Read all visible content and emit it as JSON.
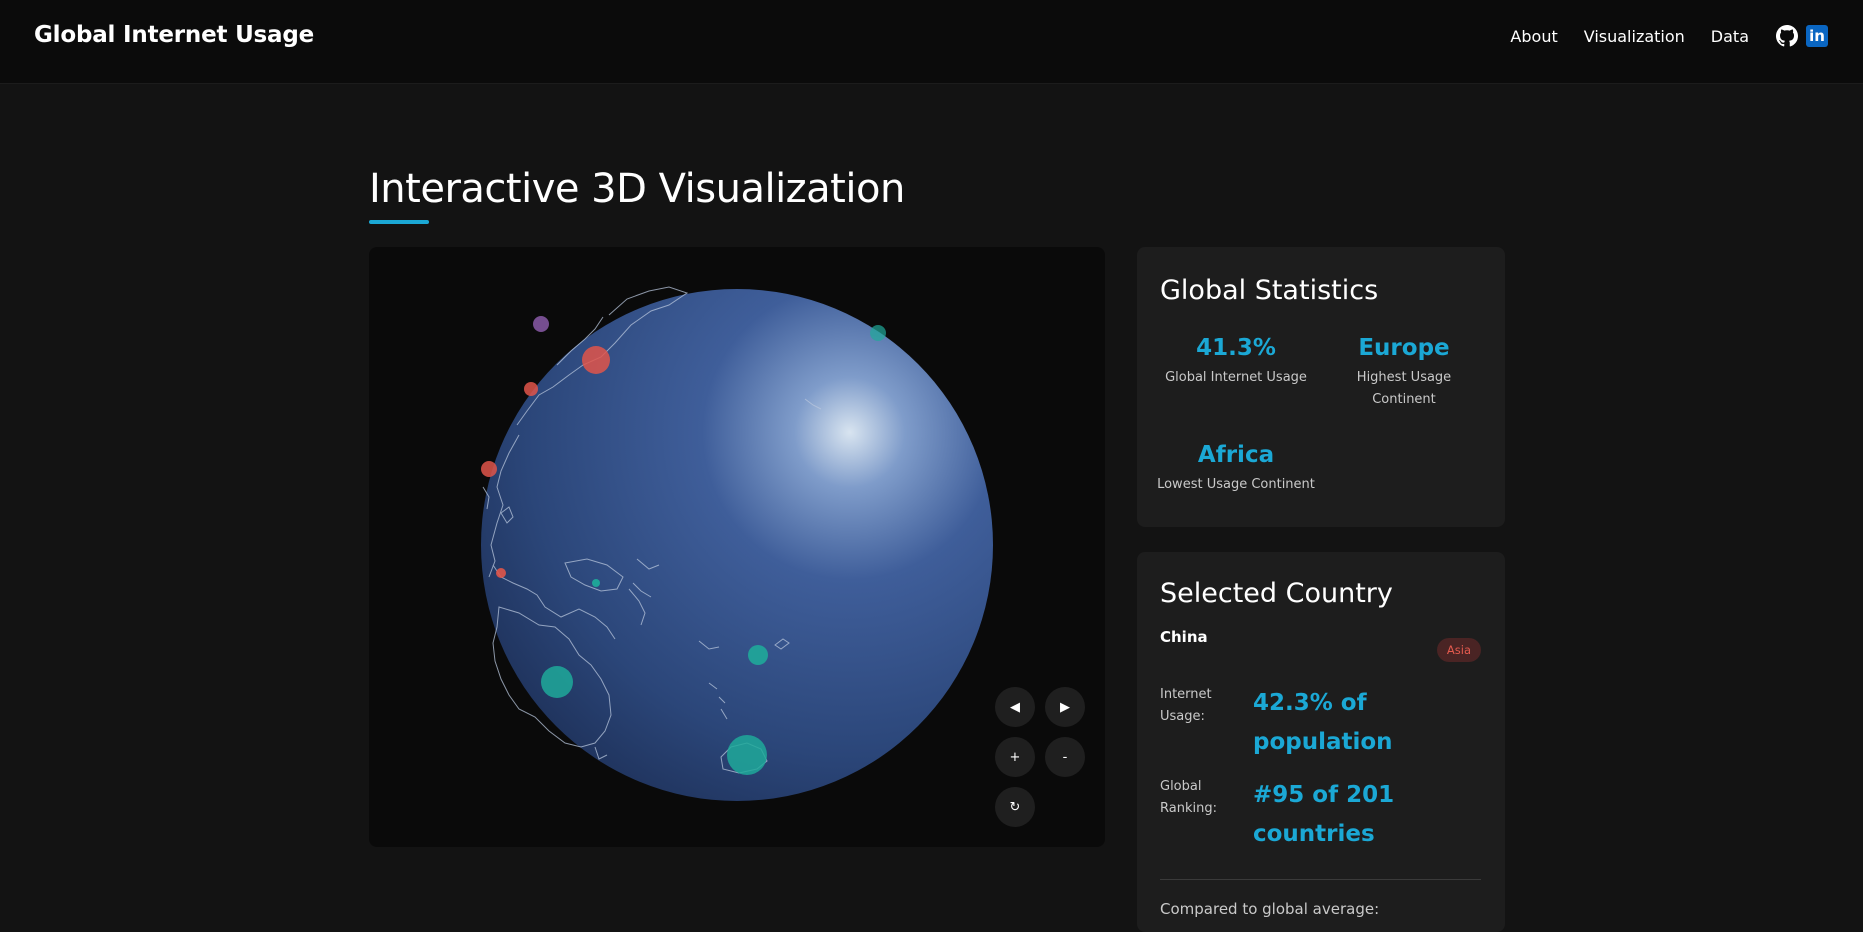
{
  "header": {
    "brand": "Global Internet Usage",
    "nav": [
      "About",
      "Visualization",
      "Data"
    ],
    "icons": [
      "github-icon",
      "linkedin-icon"
    ],
    "linkedin_glyph": "in"
  },
  "section": {
    "title": "Interactive 3D Visualization"
  },
  "globe_controls": {
    "rotate_left": "◀",
    "rotate_right": "▶",
    "zoom_in": "+",
    "zoom_out": "-",
    "reset": "↻"
  },
  "global_stats": {
    "title": "Global Statistics",
    "usage_value": "41.3%",
    "usage_label": "Global Internet Usage",
    "highest_value": "Europe",
    "highest_label": "Highest Usage Continent",
    "lowest_value": "Africa",
    "lowest_label": "Lowest Usage Continent"
  },
  "selected_country": {
    "title": "Selected Country",
    "name": "China",
    "continent": "Asia",
    "internet_label": "Internet Usage:",
    "internet_value": "42.3% of population",
    "ranking_label": "Global Ranking:",
    "ranking_value": "#95 of 201 countries",
    "compare_label": "Compared to global average:"
  },
  "colors": {
    "accent": "#1ba8d5",
    "marker_high": "#1fa99a",
    "marker_low": "#e0554a",
    "marker_mid": "#8a5aa8",
    "badge_text": "#e45a4e"
  }
}
